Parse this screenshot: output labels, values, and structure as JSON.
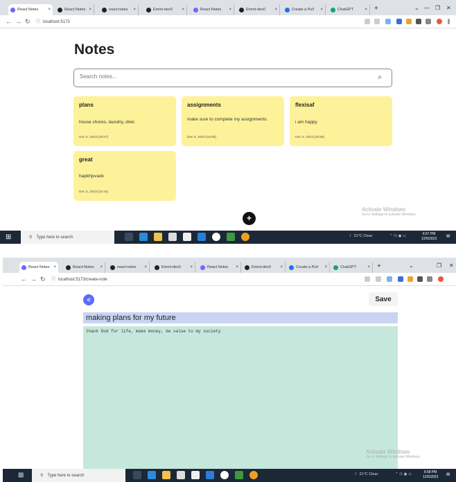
{
  "shot1": {
    "tabs": [
      {
        "label": "React Notes",
        "icon_color": "#7b61ff",
        "active": true
      },
      {
        "label": "React Notes",
        "icon_color": "#222222"
      },
      {
        "label": "react-notes",
        "icon_color": "#222222"
      },
      {
        "label": "Emmi-dev0",
        "icon_color": "#222222"
      },
      {
        "label": "React Notes",
        "icon_color": "#7b61ff"
      },
      {
        "label": "Emmi-dev0",
        "icon_color": "#222222"
      },
      {
        "label": "Create a Pull",
        "icon_color": "#1a73e8"
      },
      {
        "label": "ChatGPT",
        "icon_color": "#10a37f"
      }
    ],
    "address": "localhost:5173",
    "page_title": "Notes",
    "search_placeholder": "Search notes...",
    "notes": [
      {
        "title": "plans",
        "text": "house chores, laundry, drier.",
        "date": "Dec 5, 2023 [18:57]"
      },
      {
        "title": "assignments",
        "text": "make sure to complete my assignments.",
        "date": "Dec 5, 2023 [18:56]"
      },
      {
        "title": "flexisaf",
        "text": "i am happy",
        "date": "Dec 5, 2023 [18:56]"
      },
      {
        "title": "great",
        "text": "hapkhjvvadv",
        "date": "Dec 5, 2023 [18:44]"
      }
    ],
    "add_button_glyph": "+",
    "watermark": {
      "line1": "Activate Windows",
      "line2": "Go to Settings to activate Windows."
    },
    "taskbar": {
      "search": "Type here to search",
      "weather": "21°C Clear",
      "time": "6:57 PM",
      "date": "12/5/2023"
    }
  },
  "shot2": {
    "tabs": [
      {
        "label": "React Notes",
        "icon_color": "#7b61ff",
        "active": true
      },
      {
        "label": "React-Notes",
        "icon_color": "#222222"
      },
      {
        "label": "react-notes",
        "icon_color": "#222222"
      },
      {
        "label": "Emmi-dev0",
        "icon_color": "#222222"
      },
      {
        "label": "React Notes",
        "icon_color": "#7b61ff"
      },
      {
        "label": "Emmi-dev0",
        "icon_color": "#222222"
      },
      {
        "label": "Create a Pull",
        "icon_color": "#1a73e8"
      },
      {
        "label": "ChatGPT",
        "icon_color": "#10a37f"
      }
    ],
    "address": "localhost:5173/create-note",
    "back_glyph": "<",
    "save_label": "Save",
    "title_value": "making plans for my future",
    "details_value": "thank God for life, make money, be value to my society",
    "watermark": {
      "line1": "Activate Windows",
      "line2": "Go to Settings to activate Windows."
    },
    "taskbar": {
      "search": "Type here to search",
      "weather": "21°C Clear",
      "time": "6:58 PM",
      "date": "12/5/2023"
    }
  }
}
